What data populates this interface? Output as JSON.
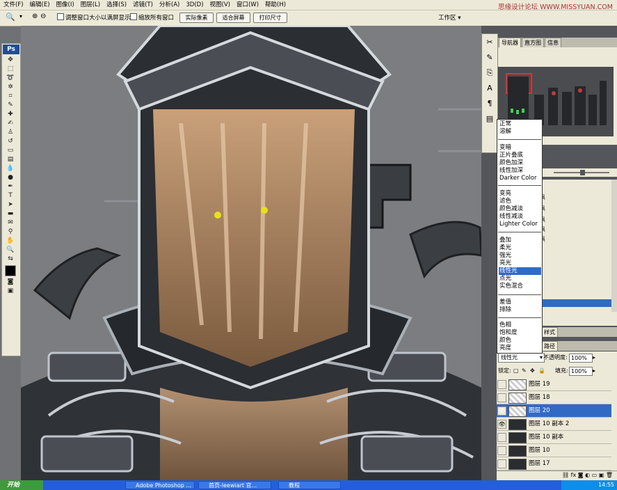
{
  "menu": [
    "文件(F)",
    "编辑(E)",
    "图像(I)",
    "图层(L)",
    "选择(S)",
    "滤镜(T)",
    "分析(A)",
    "3D(D)",
    "视图(V)",
    "窗口(W)",
    "帮助(H)"
  ],
  "watermark": "思缘设计论坛 WWW.MISSYUAN.COM",
  "options": {
    "check1": "调整窗口大小以满屏显示",
    "check2": "缩放所有窗口",
    "btn_actual": "实际像素",
    "btn_fit": "适合屏幕",
    "btn_print": "打印尺寸",
    "workspace": "工作区 ▾"
  },
  "panel_tabs": [
    "导航器",
    "直方图",
    "信息"
  ],
  "styles_tab": "样式",
  "paths_tab": "路径",
  "history_items": [
    "具",
    "具",
    "具",
    "具",
    "具"
  ],
  "blend_menu": {
    "groups": [
      [
        "正常",
        "溶解"
      ],
      [
        "变暗",
        "正片叠底",
        "颜色加深",
        "线性加深",
        "Darker Color"
      ],
      [
        "变亮",
        "滤色",
        "颜色减淡",
        "线性减淡",
        "Lighter Color"
      ],
      [
        "叠加",
        "柔光",
        "强光",
        "亮光",
        "线性光",
        "点光",
        "实色混合"
      ],
      [
        "差值",
        "排除"
      ],
      [
        "色相",
        "饱和度",
        "颜色",
        "亮度"
      ]
    ],
    "selected": "线性光"
  },
  "layers_panel": {
    "blend_mode": "线性光",
    "opacity_label": "不透明度:",
    "opacity": "100%",
    "lock_label": "锁定:",
    "fill_label": "填充:",
    "fill": "100%",
    "layers": [
      {
        "name": "图层 19",
        "visible": false,
        "dark": false
      },
      {
        "name": "图层 18",
        "visible": false,
        "dark": false
      },
      {
        "name": "图层 20",
        "visible": true,
        "dark": false,
        "selected": true
      },
      {
        "name": "图层 10 副本 2",
        "visible": true,
        "dark": true
      },
      {
        "name": "图层 10 副本",
        "visible": false,
        "dark": true
      },
      {
        "name": "图层 10",
        "visible": false,
        "dark": true
      },
      {
        "name": "图层 17",
        "visible": false,
        "dark": true
      }
    ]
  },
  "taskbar": {
    "start": "开始",
    "tasks": [
      "Adobe Photoshop ...",
      "首页-leewiart 官...",
      "教程"
    ],
    "clock": "14:55"
  },
  "colors": {
    "selection": "#316ac5",
    "panel": "#ece9d8",
    "taskbar": "#245edb"
  }
}
